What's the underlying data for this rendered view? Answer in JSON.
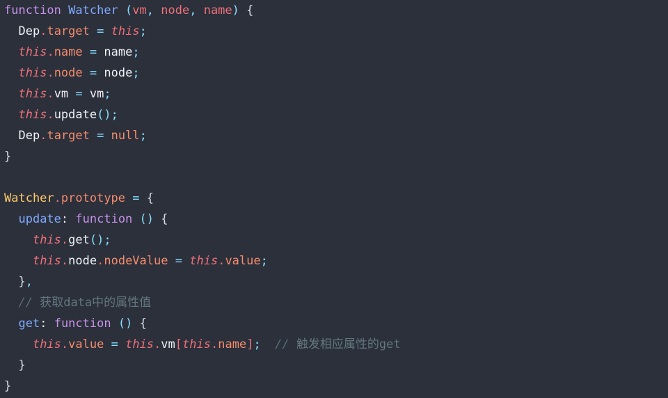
{
  "editor": {
    "language": "javascript",
    "background_color": "#2b303b",
    "foreground_color": "#eff1f5",
    "font_size_px": 17,
    "line_height_px": 30,
    "total_lines": 19
  },
  "theme_colors": {
    "keyword": "#c792ea",
    "function_name": "#82aaff",
    "parameter": "#f07178",
    "punctuation": "#89ddff",
    "brace": "#d8dee9",
    "plain": "#eff1f5",
    "this_keyword": "#f07178",
    "property": "#f78c6c",
    "operator": "#89ddff",
    "null_literal": "#f78c6c",
    "class_reference": "#ffcb6b",
    "comment": "#63777f"
  },
  "code": {
    "lines": [
      {
        "n": 1,
        "text": "function Watcher (vm, node, name) {",
        "tokens": [
          {
            "t": "function",
            "c": "t-kw"
          },
          {
            "t": " ",
            "c": "t-plain"
          },
          {
            "t": "Watcher",
            "c": "t-fnname"
          },
          {
            "t": " ",
            "c": "t-plain"
          },
          {
            "t": "(",
            "c": "t-punct"
          },
          {
            "t": "vm",
            "c": "t-param"
          },
          {
            "t": ", ",
            "c": "t-semi"
          },
          {
            "t": "node",
            "c": "t-param"
          },
          {
            "t": ", ",
            "c": "t-semi"
          },
          {
            "t": "name",
            "c": "t-param"
          },
          {
            "t": ")",
            "c": "t-punct"
          },
          {
            "t": " ",
            "c": "t-plain"
          },
          {
            "t": "{",
            "c": "t-brace"
          }
        ]
      },
      {
        "n": 2,
        "text": "  Dep.target = this;",
        "tokens": [
          {
            "t": "  ",
            "c": "t-plain"
          },
          {
            "t": "Dep",
            "c": "t-plain"
          },
          {
            "t": ".",
            "c": "t-dot"
          },
          {
            "t": "target",
            "c": "t-prop"
          },
          {
            "t": " ",
            "c": "t-plain"
          },
          {
            "t": "=",
            "c": "t-op"
          },
          {
            "t": " ",
            "c": "t-plain"
          },
          {
            "t": "this",
            "c": "t-this"
          },
          {
            "t": ";",
            "c": "t-semi"
          }
        ]
      },
      {
        "n": 3,
        "text": "  this.name = name;",
        "tokens": [
          {
            "t": "  ",
            "c": "t-plain"
          },
          {
            "t": "this",
            "c": "t-this"
          },
          {
            "t": ".",
            "c": "t-dot"
          },
          {
            "t": "name",
            "c": "t-prop"
          },
          {
            "t": " ",
            "c": "t-plain"
          },
          {
            "t": "=",
            "c": "t-op"
          },
          {
            "t": " ",
            "c": "t-plain"
          },
          {
            "t": "name",
            "c": "t-plain"
          },
          {
            "t": ";",
            "c": "t-semi"
          }
        ]
      },
      {
        "n": 4,
        "text": "  this.node = node;",
        "tokens": [
          {
            "t": "  ",
            "c": "t-plain"
          },
          {
            "t": "this",
            "c": "t-this"
          },
          {
            "t": ".",
            "c": "t-dot"
          },
          {
            "t": "node",
            "c": "t-prop"
          },
          {
            "t": " ",
            "c": "t-plain"
          },
          {
            "t": "=",
            "c": "t-op"
          },
          {
            "t": " ",
            "c": "t-plain"
          },
          {
            "t": "node",
            "c": "t-plain"
          },
          {
            "t": ";",
            "c": "t-semi"
          }
        ]
      },
      {
        "n": 5,
        "text": "  this.vm = vm;",
        "tokens": [
          {
            "t": "  ",
            "c": "t-plain"
          },
          {
            "t": "this",
            "c": "t-this"
          },
          {
            "t": ".",
            "c": "t-dot"
          },
          {
            "t": "vm",
            "c": "t-plain"
          },
          {
            "t": " ",
            "c": "t-plain"
          },
          {
            "t": "=",
            "c": "t-op"
          },
          {
            "t": " ",
            "c": "t-plain"
          },
          {
            "t": "vm",
            "c": "t-plain"
          },
          {
            "t": ";",
            "c": "t-semi"
          }
        ]
      },
      {
        "n": 6,
        "text": "  this.update();",
        "tokens": [
          {
            "t": "  ",
            "c": "t-plain"
          },
          {
            "t": "this",
            "c": "t-this"
          },
          {
            "t": ".",
            "c": "t-dot"
          },
          {
            "t": "update",
            "c": "t-plain"
          },
          {
            "t": "()",
            "c": "t-punct"
          },
          {
            "t": ";",
            "c": "t-semi"
          }
        ]
      },
      {
        "n": 7,
        "text": "  Dep.target = null;",
        "tokens": [
          {
            "t": "  ",
            "c": "t-plain"
          },
          {
            "t": "Dep",
            "c": "t-plain"
          },
          {
            "t": ".",
            "c": "t-dot"
          },
          {
            "t": "target",
            "c": "t-prop"
          },
          {
            "t": " ",
            "c": "t-plain"
          },
          {
            "t": "=",
            "c": "t-op"
          },
          {
            "t": " ",
            "c": "t-plain"
          },
          {
            "t": "null",
            "c": "t-null"
          },
          {
            "t": ";",
            "c": "t-semi"
          }
        ]
      },
      {
        "n": 8,
        "text": "}",
        "tokens": [
          {
            "t": "}",
            "c": "t-brace"
          }
        ]
      },
      {
        "n": 9,
        "text": "",
        "tokens": []
      },
      {
        "n": 10,
        "text": "Watcher.prototype = {",
        "tokens": [
          {
            "t": "Watcher",
            "c": "t-class"
          },
          {
            "t": ".",
            "c": "t-dot"
          },
          {
            "t": "prototype",
            "c": "t-prop"
          },
          {
            "t": " ",
            "c": "t-plain"
          },
          {
            "t": "=",
            "c": "t-op"
          },
          {
            "t": " ",
            "c": "t-plain"
          },
          {
            "t": "{",
            "c": "t-brace"
          }
        ]
      },
      {
        "n": 11,
        "text": "  update: function () {",
        "tokens": [
          {
            "t": "  ",
            "c": "t-plain"
          },
          {
            "t": "update",
            "c": "t-fnname"
          },
          {
            "t": ":",
            "c": "t-plain"
          },
          {
            "t": " ",
            "c": "t-plain"
          },
          {
            "t": "function",
            "c": "t-kw"
          },
          {
            "t": " ",
            "c": "t-plain"
          },
          {
            "t": "()",
            "c": "t-punct"
          },
          {
            "t": " ",
            "c": "t-plain"
          },
          {
            "t": "{",
            "c": "t-brace"
          }
        ]
      },
      {
        "n": 12,
        "text": "    this.get();",
        "tokens": [
          {
            "t": "    ",
            "c": "t-plain"
          },
          {
            "t": "this",
            "c": "t-this"
          },
          {
            "t": ".",
            "c": "t-dot"
          },
          {
            "t": "get",
            "c": "t-plain"
          },
          {
            "t": "()",
            "c": "t-punct"
          },
          {
            "t": ";",
            "c": "t-semi"
          }
        ]
      },
      {
        "n": 13,
        "text": "    this.node.nodeValue = this.value;",
        "tokens": [
          {
            "t": "    ",
            "c": "t-plain"
          },
          {
            "t": "this",
            "c": "t-this"
          },
          {
            "t": ".",
            "c": "t-dot"
          },
          {
            "t": "node",
            "c": "t-plain"
          },
          {
            "t": ".",
            "c": "t-dot"
          },
          {
            "t": "nodeValue",
            "c": "t-prop"
          },
          {
            "t": " ",
            "c": "t-plain"
          },
          {
            "t": "=",
            "c": "t-op"
          },
          {
            "t": " ",
            "c": "t-plain"
          },
          {
            "t": "this",
            "c": "t-this"
          },
          {
            "t": ".",
            "c": "t-dot"
          },
          {
            "t": "value",
            "c": "t-prop"
          },
          {
            "t": ";",
            "c": "t-semi"
          }
        ]
      },
      {
        "n": 14,
        "text": "  },",
        "tokens": [
          {
            "t": "  ",
            "c": "t-plain"
          },
          {
            "t": "}",
            "c": "t-brace"
          },
          {
            "t": ",",
            "c": "t-semi"
          }
        ]
      },
      {
        "n": 15,
        "text": "  // 获取data中的属性值",
        "tokens": [
          {
            "t": "  ",
            "c": "t-plain"
          },
          {
            "t": "// ",
            "c": "t-comment"
          },
          {
            "t": "获取data中的属性值",
            "c": "t-comment-cn"
          }
        ]
      },
      {
        "n": 16,
        "text": "  get: function () {",
        "tokens": [
          {
            "t": "  ",
            "c": "t-plain"
          },
          {
            "t": "get",
            "c": "t-fnname"
          },
          {
            "t": ":",
            "c": "t-plain"
          },
          {
            "t": " ",
            "c": "t-plain"
          },
          {
            "t": "function",
            "c": "t-kw"
          },
          {
            "t": " ",
            "c": "t-plain"
          },
          {
            "t": "()",
            "c": "t-punct"
          },
          {
            "t": " ",
            "c": "t-plain"
          },
          {
            "t": "{",
            "c": "t-brace"
          }
        ]
      },
      {
        "n": 17,
        "text": "    this.value = this.vm[this.name]; // 触发相应属性的get",
        "tokens": [
          {
            "t": "    ",
            "c": "t-plain"
          },
          {
            "t": "this",
            "c": "t-this"
          },
          {
            "t": ".",
            "c": "t-dot"
          },
          {
            "t": "value",
            "c": "t-prop"
          },
          {
            "t": " ",
            "c": "t-plain"
          },
          {
            "t": "=",
            "c": "t-op"
          },
          {
            "t": " ",
            "c": "t-plain"
          },
          {
            "t": "this",
            "c": "t-this"
          },
          {
            "t": ".",
            "c": "t-dot"
          },
          {
            "t": "vm",
            "c": "t-plain"
          },
          {
            "t": "[",
            "c": "t-dot"
          },
          {
            "t": "this",
            "c": "t-this"
          },
          {
            "t": ".",
            "c": "t-dot"
          },
          {
            "t": "name",
            "c": "t-prop"
          },
          {
            "t": "]",
            "c": "t-dot"
          },
          {
            "t": ";",
            "c": "t-semi"
          },
          {
            "t": "  ",
            "c": "t-plain"
          },
          {
            "t": "// ",
            "c": "t-comment"
          },
          {
            "t": "触发相应属性的get",
            "c": "t-comment-cn"
          }
        ]
      },
      {
        "n": 18,
        "text": "  }",
        "tokens": [
          {
            "t": "  ",
            "c": "t-plain"
          },
          {
            "t": "}",
            "c": "t-brace"
          }
        ]
      },
      {
        "n": 19,
        "text": "}",
        "tokens": [
          {
            "t": "}",
            "c": "t-brace"
          }
        ]
      }
    ]
  }
}
